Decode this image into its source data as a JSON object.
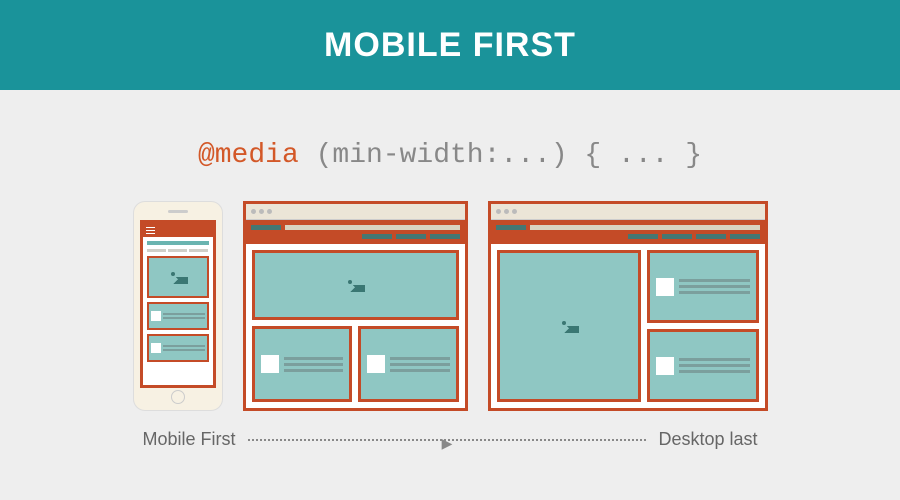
{
  "header": {
    "title": "MOBILE FIRST"
  },
  "code": {
    "keyword": "@media",
    "rest": " (min-width:...) { ... }"
  },
  "caption": {
    "left": "Mobile First",
    "right": "Desktop last"
  }
}
